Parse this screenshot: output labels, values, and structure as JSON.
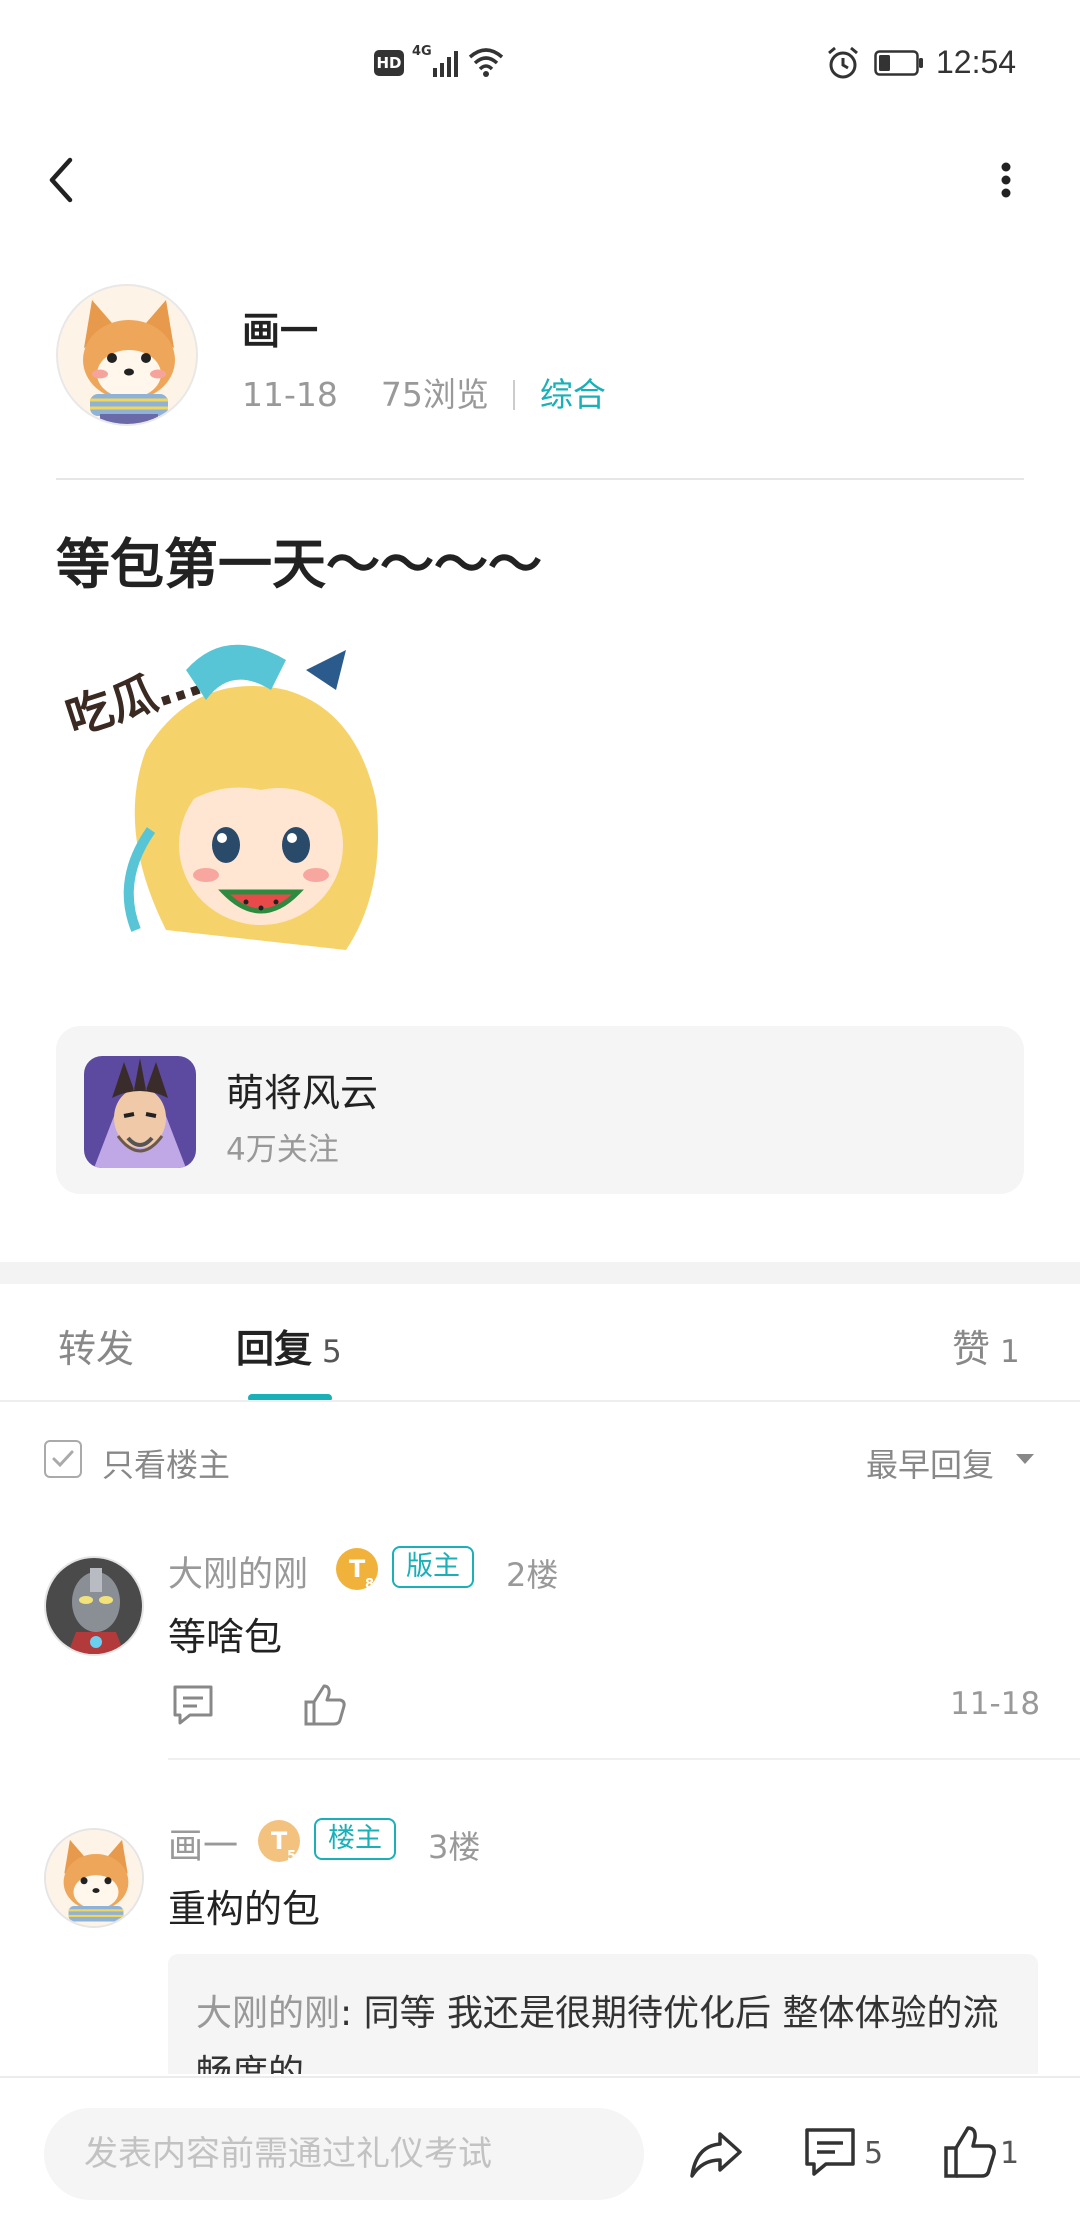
{
  "status_bar": {
    "hd": "HD",
    "network": "4G",
    "time": "12:54"
  },
  "author": {
    "name": "画一",
    "date": "11-18",
    "views": "75浏览",
    "category": "综合"
  },
  "post": {
    "title": "等包第一天～～～～",
    "sticker_text": "吃瓜…"
  },
  "community": {
    "name": "萌将风云",
    "followers": "4万关注"
  },
  "tabs": {
    "forward": "转发",
    "reply": "回复",
    "reply_count": "5",
    "like": "赞",
    "like_count": "1"
  },
  "filter": {
    "only_owner": "只看楼主",
    "sort": "最早回复"
  },
  "comments": [
    {
      "name": "大刚的刚",
      "level": "T",
      "level_num": "8",
      "role": "版主",
      "floor": "2楼",
      "content": "等啥包",
      "time": "11-18"
    },
    {
      "name": "画一",
      "level": "T",
      "level_num": "5",
      "role": "楼主",
      "floor": "3楼",
      "content": "重构的包",
      "quote_user": "大刚的刚",
      "quote_text": ": 同等 我还是很期待优化后 整体体验的流畅度的"
    }
  ],
  "bottom_bar": {
    "placeholder": "发表内容前需通过礼仪考试",
    "comment_count": "5",
    "like_count": "1"
  },
  "colors": {
    "accent": "#1ab0b8",
    "level_gold": "#f0b23a",
    "level_light": "#f3c27e"
  }
}
